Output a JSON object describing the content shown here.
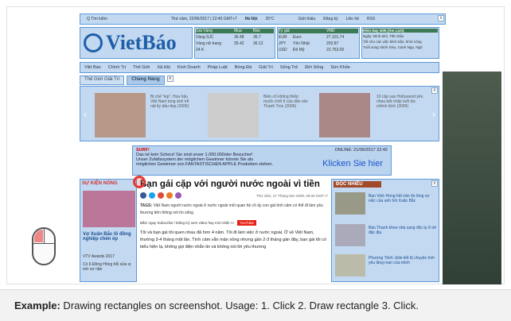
{
  "topbar": {
    "search": "Q Tìm kiếm",
    "date": "Thứ năm, 22/06/2017 | 22:40 GMT+7",
    "city": "Hà Nội",
    "temp": "25°C",
    "links": [
      "Giới thiệu",
      "Đăng ký",
      "Liên hệ",
      "RSS"
    ]
  },
  "logo": "VietBáo",
  "gold": {
    "headers": [
      "Giá Vàng",
      "Mua",
      "Bán"
    ],
    "rows": [
      [
        "Vàng SJC",
        "36.48",
        "36.7"
      ],
      [
        "Vàng nữ trang",
        "35.42",
        "36.12"
      ],
      [
        "24 K",
        "",
        ""
      ]
    ]
  },
  "fx": {
    "headers": [
      "Tỷ giá",
      "",
      "VND"
    ],
    "rows": [
      [
        "EUR",
        "Euro",
        "27.101.74"
      ],
      [
        "JPY",
        "Yên Nhật",
        "203.87"
      ],
      [
        "USD",
        "Đô Mỹ",
        "22.763.00"
      ]
    ]
  },
  "today": {
    "title": "Hôm Nay 30/6 (Âm Lịch)",
    "lines": [
      "Ngày: Đinh Mùi, Tiên Dậu",
      "Tốt cho các việc khởi trận, khởi công",
      "Tuổi xung: Đinh Sửu, Canh Ngọ, Ngô"
    ]
  },
  "nav": [
    "Việt Báo",
    "Chính Trị",
    "Thế Giới",
    "Xã Hội",
    "Kinh Doanh",
    "Pháp Luật",
    "Bóng Đá",
    "Giải Trí",
    "Sống Trẻ",
    "Đời Sống",
    "Sức Khỏe"
  ],
  "tabs": [
    "Thế Giới Giải Trí",
    "Chàng Nàng"
  ],
  "stories": [
    "Bị chê \"kịp\", Hoa hậu Việt Nam tung ảnh trễ nải ký dấu đẹp (2006)",
    "Biến cố không thiếp muốn chết tỉ của dân văn Thanh Trúc (2009)",
    "10 cặp sao Hollywood yêu nhau bất chấp tuổi tác chênh lệch (2006)"
  ],
  "banner": {
    "label": "SURF!",
    "online": "ONLINE: 21/09/2017 22:42",
    "lines": [
      "Das ist kein Scherz! Sie sind unser 1.000.000ster Besucher!",
      "Unser Zufallssystem der möglichen Gewinner könnte Sie als",
      "möglichen Gewinner von FANTASTISCHEN APPLE Produkten ziehen."
    ],
    "cta": "Klicken Sie hier"
  },
  "left_col": {
    "header": "SỰ KIỆN NÓNG",
    "caption": "Vợ Xuân Bắc lồ đồng nghiệp chén ép",
    "items": [
      "VTV Awards 2017",
      "Có 6 Đông Hồng hỗi sửa vị mờ vợ nặn"
    ]
  },
  "article": {
    "title": "Bạn gái cặp với người nước ngoài vì tiền",
    "meta": "Thứ năm, 27 Tháng tám 2009, 09:00 GMT+7",
    "tags_label": "TAGS:",
    "tags": "Việt Nam  người nước ngoài  ở nước ngoài  mối quan hệ  cô ấy  con gái  tình cảm  có thể  đi làm  yêu thương  tiền  thông  nói  tín  sống",
    "subscribe": "Bấm ngay Subscribe / Đăng Ký xem video hay mới nhất >>",
    "youtube": "YouTube",
    "body": "Tôi và bạn gái tôi quen nhau đã hơn 4 năm. Tôi đi làm việc ở nước ngoài. Ở về Việt Nam, thường 3-4 tháng một lần. Tình cảm vẫn mặn nồng nhưng gần 2-3 tháng gần đây, bạn gái tôi có biểu hiện lạ, không gọi điện nhắn tin và không nói lời yêu thương"
  },
  "right_col": {
    "header": "ĐỌC NHIỀU",
    "items": [
      "Ban Vinh Hong hết não ôn lòng vợ việc của anh hồi Xuân Bắc",
      "Bảo Thanh khoe nhà sang độc lạ ở trẻ đặc địa",
      "Phương Trinh Jolie tiết lộ chuyện tình yêu lãng mạn của mình"
    ]
  },
  "caption": {
    "bold": "Example:",
    "text": " Drawing rectangles on screenshot. Usage: 1. Click 2. Draw rectangle 3. Click."
  },
  "colors": {
    "overlay": "#78aae1",
    "logo": "#1f5ea8",
    "accent": "#e53935"
  }
}
